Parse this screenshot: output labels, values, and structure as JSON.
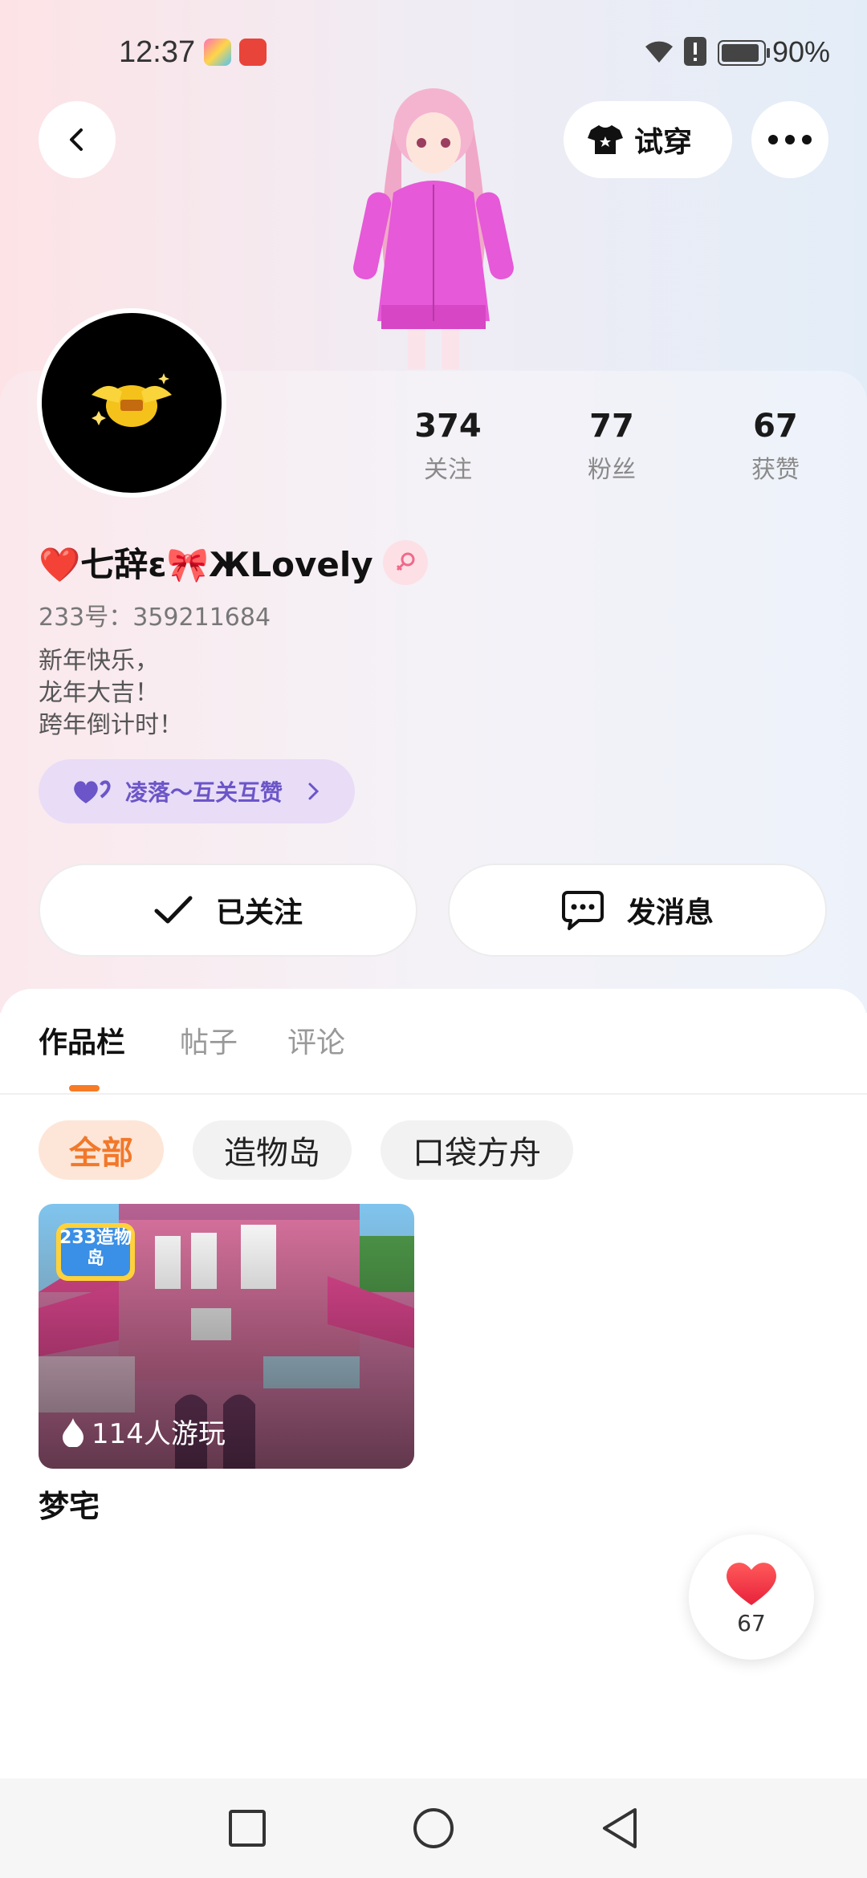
{
  "status_bar": {
    "time": "12:37",
    "battery_percent": "90%",
    "battery_level": 0.9,
    "app_icons": [
      "tips-app-icon",
      "huawei-appgallery-icon"
    ]
  },
  "header": {
    "back_icon": "chevron-left-icon",
    "try_on_label": "试穿",
    "more_icon": "more-dots-icon"
  },
  "profile": {
    "name": "❤️七辞ε🎀ЖLovely",
    "gender_icon": "female-icon",
    "uid": "233号：359211684",
    "bio": "新年快乐，\n龙年大吉！\n跨年倒计时！",
    "tag_label": "凌落～互关互赞",
    "stats": [
      {
        "num": "374",
        "label": "关注"
      },
      {
        "num": "77",
        "label": "粉丝"
      },
      {
        "num": "67",
        "label": "获赞"
      }
    ]
  },
  "actions": {
    "follow_label": "已关注",
    "message_label": "发消息"
  },
  "tabs": [
    "作品栏",
    "帖子",
    "评论"
  ],
  "active_tab": 0,
  "filters": [
    "全部",
    "造物岛",
    "口袋方舟"
  ],
  "active_filter": 0,
  "works": [
    {
      "title": "梦宅",
      "players": "114人游玩",
      "badge_text": "233造物岛"
    }
  ],
  "like_fab": {
    "count": "67"
  },
  "colors": {
    "accent": "#f77a25",
    "tag_bg": "#e8dcf7",
    "tag_text": "#6b55c8",
    "heart": "#f0303a"
  }
}
